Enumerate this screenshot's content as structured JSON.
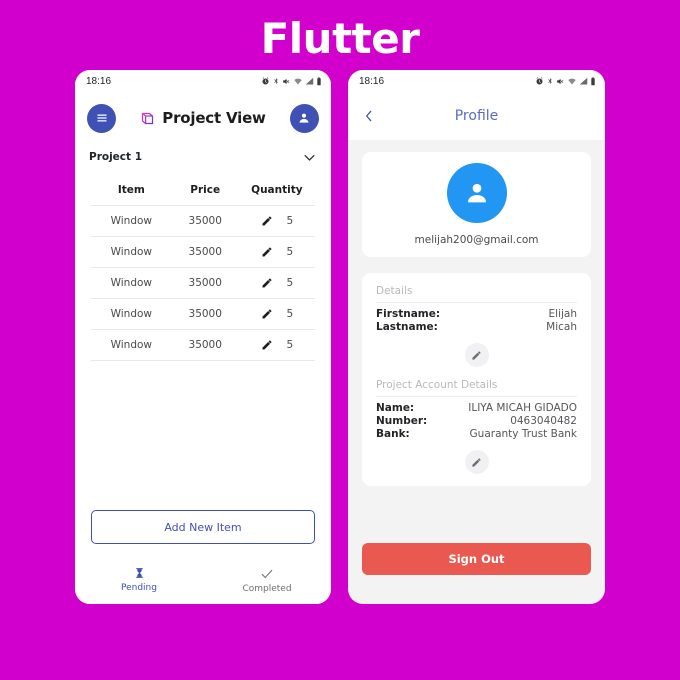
{
  "brand": {
    "title": "Flutter",
    "background_color": "#d200cd"
  },
  "colors": {
    "indigo": "#3f51b5",
    "avatar_blue": "#2196f3",
    "signout_red": "#e9594f",
    "profile_title": "#5a6bc4"
  },
  "phone_left": {
    "statusbar": {
      "clock": "18:16",
      "icons": [
        "alarm-icon",
        "bluetooth-icon",
        "mute-icon",
        "wifi-icon",
        "signal-icon",
        "battery-icon"
      ]
    },
    "appbar": {
      "menu_icon": "hamburger-menu-icon",
      "logo_icon": "flutter-cube-icon",
      "title": "Project View",
      "account_icon": "person-icon"
    },
    "project_selector": {
      "name": "Project 1",
      "chevron_icon": "chevron-down-icon"
    },
    "table": {
      "headers": [
        "Item",
        "Price",
        "Quantity"
      ],
      "rows": [
        {
          "item": "Window",
          "price": "35000",
          "quantity": "5",
          "edit_icon": "pencil-icon"
        },
        {
          "item": "Window",
          "price": "35000",
          "quantity": "5",
          "edit_icon": "pencil-icon"
        },
        {
          "item": "Window",
          "price": "35000",
          "quantity": "5",
          "edit_icon": "pencil-icon"
        },
        {
          "item": "Window",
          "price": "35000",
          "quantity": "5",
          "edit_icon": "pencil-icon"
        },
        {
          "item": "Window",
          "price": "35000",
          "quantity": "5",
          "edit_icon": "pencil-icon"
        }
      ]
    },
    "add_button_label": "Add New Item",
    "bottom_nav": [
      {
        "label": "Pending",
        "icon": "hourglass-icon",
        "active": true
      },
      {
        "label": "Completed",
        "icon": "check-icon",
        "active": false
      }
    ]
  },
  "phone_right": {
    "statusbar": {
      "clock": "18:16",
      "icons": [
        "alarm-icon",
        "bluetooth-icon",
        "mute-icon",
        "wifi-icon",
        "signal-icon",
        "battery-icon"
      ]
    },
    "appbar": {
      "back_icon": "chevron-left-icon",
      "title": "Profile"
    },
    "avatar_card": {
      "avatar_icon": "person-icon",
      "email": "melijah200@gmail.com"
    },
    "details_card": {
      "section_title": "Details",
      "fields": [
        {
          "label": "Firstname:",
          "value": "Elijah"
        },
        {
          "label": "Lastname:",
          "value": "Micah"
        }
      ],
      "edit_icon": "pencil-icon"
    },
    "account_card": {
      "section_title": "Project Account Details",
      "fields": [
        {
          "label": "Name:",
          "value": "ILIYA  MICAH GIDADO"
        },
        {
          "label": "Number:",
          "value": "0463040482"
        },
        {
          "label": "Bank:",
          "value": "Guaranty Trust Bank"
        }
      ],
      "edit_icon": "pencil-icon"
    },
    "signout_label": "Sign Out"
  }
}
